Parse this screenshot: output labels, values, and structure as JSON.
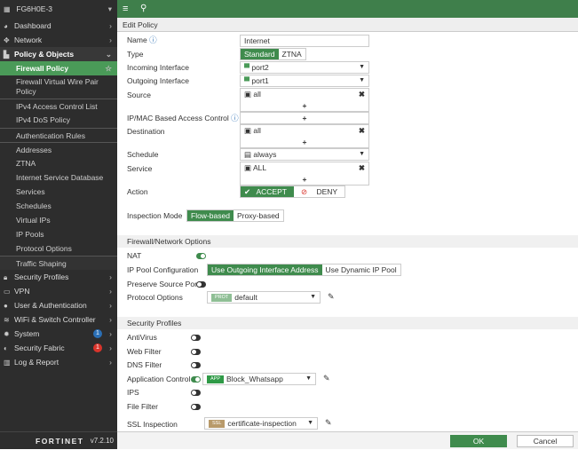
{
  "sidebar": {
    "device": "FG6H0E-3",
    "items": [
      {
        "label": "Dashboard"
      },
      {
        "label": "Network"
      },
      {
        "label": "Policy & Objects"
      },
      {
        "label": "Firewall Policy"
      },
      {
        "label": "Firewall Virtual Wire Pair Policy"
      },
      {
        "label": "IPv4 Access Control List"
      },
      {
        "label": "IPv4 DoS Policy"
      },
      {
        "label": "Authentication Rules"
      },
      {
        "label": "Addresses"
      },
      {
        "label": "ZTNA"
      },
      {
        "label": "Internet Service Database"
      },
      {
        "label": "Services"
      },
      {
        "label": "Schedules"
      },
      {
        "label": "Virtual IPs"
      },
      {
        "label": "IP Pools"
      },
      {
        "label": "Protocol Options"
      },
      {
        "label": "Traffic Shaping"
      },
      {
        "label": "Security Profiles"
      },
      {
        "label": "VPN"
      },
      {
        "label": "User & Authentication"
      },
      {
        "label": "WiFi & Switch Controller"
      },
      {
        "label": "System",
        "badge": "1"
      },
      {
        "label": "Security Fabric",
        "badge": "1"
      },
      {
        "label": "Log & Report"
      }
    ],
    "brand": "FORTINET",
    "version": "v7.2.10"
  },
  "header": {
    "title": "Edit Policy"
  },
  "form": {
    "name_label": "Name",
    "name_value": "Internet",
    "type_label": "Type",
    "type_options": [
      "Standard",
      "ZTNA"
    ],
    "incoming_label": "Incoming Interface",
    "incoming_value": "port2",
    "outgoing_label": "Outgoing Interface",
    "outgoing_value": "port1",
    "source_label": "Source",
    "source_value": "all",
    "ipmac_label": "IP/MAC Based Access Control",
    "destination_label": "Destination",
    "destination_value": "all",
    "schedule_label": "Schedule",
    "schedule_value": "always",
    "service_label": "Service",
    "service_value": "ALL",
    "action_label": "Action",
    "action_accept": "ACCEPT",
    "action_deny": "DENY",
    "inspection_label": "Inspection Mode",
    "inspection_options": [
      "Flow-based",
      "Proxy-based"
    ],
    "plus": "+"
  },
  "firewall": {
    "title": "Firewall/Network Options",
    "nat_label": "NAT",
    "ippool_label": "IP Pool Configuration",
    "ippool_options": [
      "Use Outgoing Interface Address",
      "Use Dynamic IP Pool"
    ],
    "preserve_label": "Preserve Source Port",
    "protocol_label": "Protocol Options",
    "protocol_tag": "PROT",
    "protocol_value": "default"
  },
  "security": {
    "title": "Security Profiles",
    "antivirus": "AntiVirus",
    "webfilter": "Web Filter",
    "dnsfilter": "DNS Filter",
    "appcontrol": "Application Control",
    "app_tag": "APP",
    "app_value": "Block_Whatsapp",
    "ips": "IPS",
    "filefilter": "File Filter",
    "ssl": "SSL Inspection",
    "ssl_tag": "SSL",
    "ssl_value": "certificate-inspection"
  },
  "footer": {
    "ok": "OK",
    "cancel": "Cancel"
  }
}
